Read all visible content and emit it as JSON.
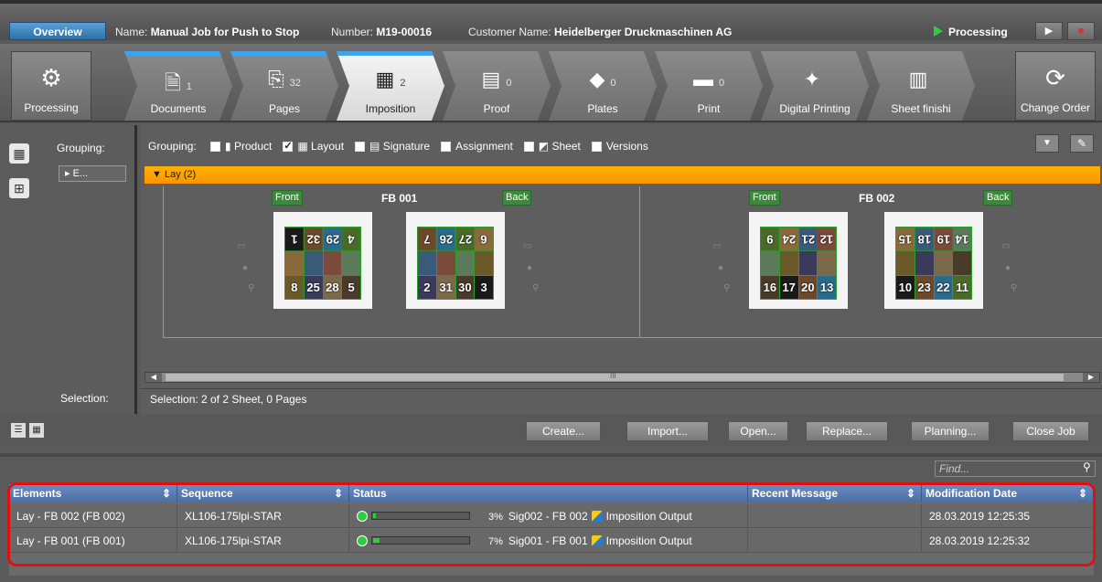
{
  "header": {
    "overview": "Overview",
    "name_label": "Name:",
    "name_value": "Manual Job for Push to Stop",
    "number_label": "Number:",
    "number_value": "M19-00016",
    "customer_label": "Customer Name:",
    "customer_value": "Heidelberger Druckmaschinen AG",
    "status": "Processing"
  },
  "workflow": {
    "left": "Processing",
    "right": "Change Order",
    "steps": [
      {
        "label": "Documents",
        "count": "1"
      },
      {
        "label": "Pages",
        "count": "32"
      },
      {
        "label": "Imposition",
        "count": "2"
      },
      {
        "label": "Proof",
        "count": "0"
      },
      {
        "label": "Plates",
        "count": "0"
      },
      {
        "label": "Print",
        "count": "0"
      },
      {
        "label": "Digital Printing",
        "count": ""
      },
      {
        "label": "Sheet finishi",
        "count": ""
      }
    ]
  },
  "left_panel": {
    "grouping": "Grouping:",
    "tree_item": "E...",
    "selection": "Selection:"
  },
  "grouping": {
    "label": "Grouping:",
    "options": [
      {
        "label": "Product",
        "checked": false
      },
      {
        "label": "Layout",
        "checked": true
      },
      {
        "label": "Signature",
        "checked": false
      },
      {
        "label": "Assignment",
        "checked": false
      },
      {
        "label": "Sheet",
        "checked": false
      },
      {
        "label": "Versions",
        "checked": false
      }
    ]
  },
  "lay": {
    "header": "Lay (2)",
    "sheets": [
      {
        "name": "FB 001",
        "front_label": "Front",
        "back_label": "Back",
        "front_pages": [
          "1",
          "32",
          "29",
          "4",
          "",
          "",
          "",
          "",
          "8",
          "25",
          "28",
          "5"
        ],
        "back_pages": [
          "7",
          "26",
          "27",
          "6",
          "",
          "",
          "",
          "",
          "2",
          "31",
          "30",
          "3"
        ]
      },
      {
        "name": "FB 002",
        "front_label": "Front",
        "back_label": "Back",
        "front_pages": [
          "9",
          "24",
          "21",
          "12",
          "",
          "",
          "",
          "",
          "16",
          "17",
          "20",
          "13"
        ],
        "back_pages": [
          "15",
          "18",
          "19",
          "14",
          "",
          "",
          "",
          "",
          "10",
          "23",
          "22",
          "11"
        ]
      }
    ]
  },
  "scroll_mark": "III",
  "selection_text": "Selection:  2 of 2 Sheet,  0 Pages",
  "actions": [
    "Create...",
    "Import...",
    "Open...",
    "Replace...",
    "Planning...",
    "Close Job"
  ],
  "find_placeholder": "Find...",
  "table": {
    "headers": [
      "Elements",
      "Sequence",
      "Status",
      "Recent Message",
      "Modification Date"
    ],
    "rows": [
      {
        "element": "Lay - FB 002 (FB 002)",
        "sequence": "XL106-175lpi-STAR",
        "progress_pct": "3%",
        "progress": 0.03,
        "sig": "Sig002 - FB 002",
        "task": "Imposition Output",
        "message": "",
        "date": "28.03.2019 12:25:35"
      },
      {
        "element": "Lay - FB 001 (FB 001)",
        "sequence": "XL106-175lpi-STAR",
        "progress_pct": "7%",
        "progress": 0.07,
        "sig": "Sig001 - FB 001",
        "task": "Imposition Output",
        "message": "",
        "date": "28.03.2019 12:25:32"
      }
    ]
  },
  "colors": {
    "accent": "#3ea3e8",
    "lay_bar": "#ff9e00",
    "status_ok": "#2ecc40",
    "highlight": "#e01010"
  }
}
